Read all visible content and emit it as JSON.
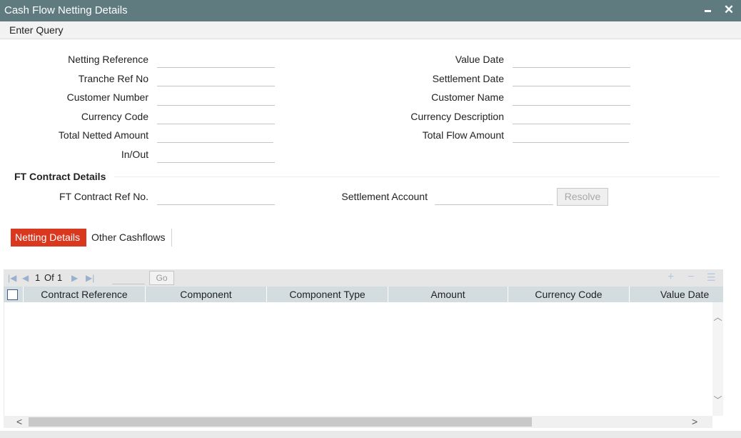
{
  "window": {
    "title": "Cash Flow Netting Details"
  },
  "toolbar": {
    "enter_query": "Enter Query"
  },
  "fields": {
    "netting_reference": "Netting Reference",
    "tranche_ref_no": "Tranche Ref No",
    "customer_number": "Customer Number",
    "currency_code": "Currency Code",
    "total_netted_amount": "Total Netted Amount",
    "in_out": "In/Out",
    "value_date": "Value Date",
    "settlement_date": "Settlement Date",
    "customer_name": "Customer Name",
    "currency_description": "Currency Description",
    "total_flow_amount": "Total Flow Amount"
  },
  "ft_section": {
    "title": "FT Contract Details",
    "ft_contract_ref_no": "FT Contract Ref No.",
    "settlement_account": "Settlement Account",
    "resolve_button": "Resolve"
  },
  "tabs": [
    {
      "label": "Netting Details",
      "active": true
    },
    {
      "label": "Other Cashflows",
      "active": false
    }
  ],
  "grid": {
    "pager": {
      "current": "1",
      "of_label": "Of",
      "total": "1",
      "go_label": "Go"
    },
    "columns": [
      "Contract Reference",
      "Component",
      "Component Type",
      "Amount",
      "Currency Code",
      "Value Date"
    ]
  },
  "icons": {
    "first": "first-page-icon",
    "prev": "prev-page-icon",
    "next": "next-page-icon",
    "last": "last-page-icon",
    "add": "add-row-icon",
    "delete": "delete-row-icon",
    "single_view": "single-view-icon"
  },
  "colors": {
    "titlebar": "#5f7b7f",
    "active_tab": "#d9381e",
    "grid_header": "#d3dde0"
  }
}
